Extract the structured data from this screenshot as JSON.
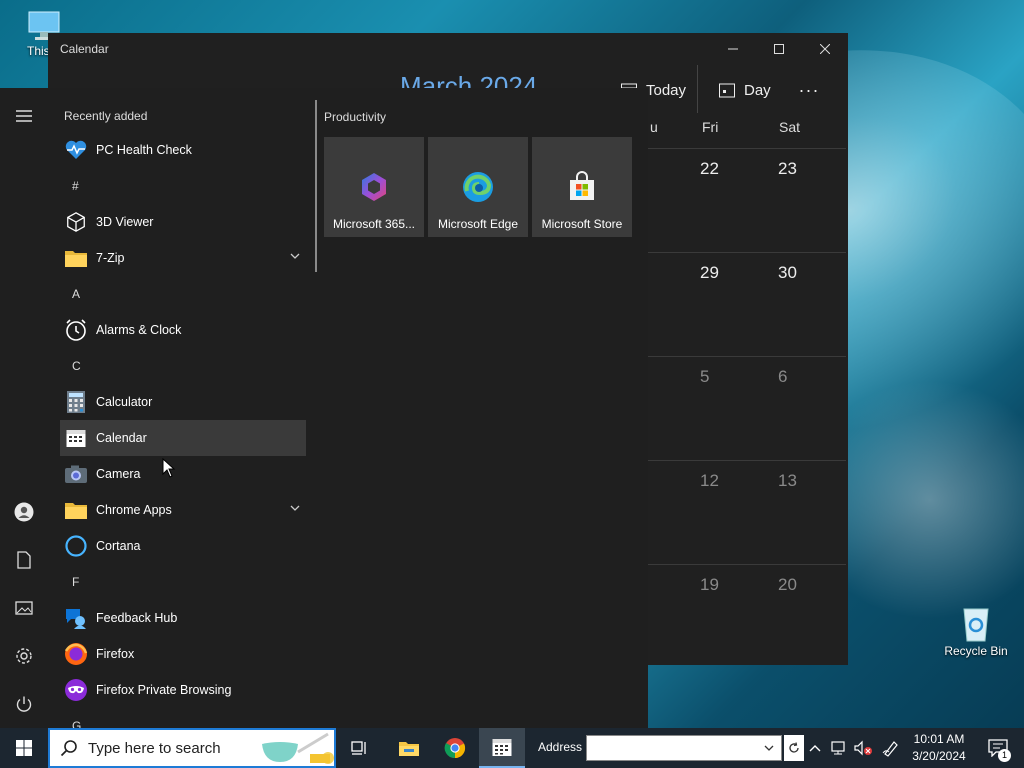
{
  "desktop": {
    "this_pc_label": "This P",
    "recycle_bin_label": "Recycle Bin"
  },
  "calendar_window": {
    "title": "Calendar",
    "month_label": "March 2024",
    "today_label": "Today",
    "view_label": "Day",
    "more_label": "···",
    "days_of_week": [
      "u",
      "Fri",
      "Sat"
    ],
    "weeks": [
      {
        "fri": "22",
        "sat": "23",
        "muted": false
      },
      {
        "fri": "29",
        "sat": "30",
        "muted": false
      },
      {
        "fri": "5",
        "sat": "6",
        "muted": true
      },
      {
        "fri": "12",
        "sat": "13",
        "muted": true
      },
      {
        "fri": "19",
        "sat": "20",
        "muted": true
      }
    ]
  },
  "start_menu": {
    "recently_added": "Recently added",
    "apps": [
      {
        "type": "app",
        "label": "PC Health Check",
        "icon": "heart-pulse-icon"
      },
      {
        "type": "letter",
        "label": "#"
      },
      {
        "type": "app",
        "label": "3D Viewer",
        "icon": "cube-icon"
      },
      {
        "type": "folder",
        "label": "7-Zip",
        "icon": "folder-icon"
      },
      {
        "type": "letter",
        "label": "A"
      },
      {
        "type": "app",
        "label": "Alarms & Clock",
        "icon": "clock-icon"
      },
      {
        "type": "letter",
        "label": "C"
      },
      {
        "type": "app",
        "label": "Calculator",
        "icon": "calculator-icon"
      },
      {
        "type": "app",
        "label": "Calendar",
        "icon": "calendar-icon",
        "selected": true
      },
      {
        "type": "app",
        "label": "Camera",
        "icon": "camera-icon"
      },
      {
        "type": "folder",
        "label": "Chrome Apps",
        "icon": "folder-icon"
      },
      {
        "type": "app",
        "label": "Cortana",
        "icon": "cortana-icon"
      },
      {
        "type": "letter",
        "label": "F"
      },
      {
        "type": "app",
        "label": "Feedback Hub",
        "icon": "feedback-icon"
      },
      {
        "type": "app",
        "label": "Firefox",
        "icon": "firefox-icon"
      },
      {
        "type": "app",
        "label": "Firefox Private Browsing",
        "icon": "mask-icon"
      },
      {
        "type": "letter",
        "label": "G"
      }
    ],
    "tiles_group": "Productivity",
    "tiles": [
      {
        "label": "Microsoft 365...",
        "icon": "m365-icon"
      },
      {
        "label": "Microsoft Edge",
        "icon": "edge-icon"
      },
      {
        "label": "Microsoft Store",
        "icon": "store-icon"
      }
    ]
  },
  "taskbar": {
    "search_placeholder": "Type here to search",
    "address_label": "Address",
    "address_value": "",
    "clock_time": "10:01 AM",
    "clock_date": "3/20/2024",
    "notification_count": "1"
  }
}
